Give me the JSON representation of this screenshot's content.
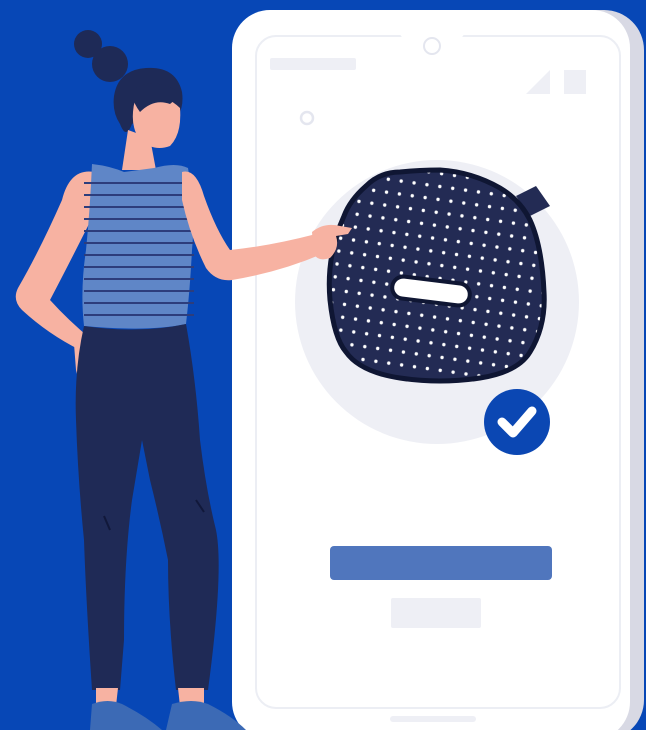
{
  "colors": {
    "background": "#0747b6",
    "phone_body": "#ffffff",
    "phone_edge": "#d8d9e4",
    "phone_shadow": "#0a3d9c",
    "screen_bg": "#ffffff",
    "placeholder_grey": "#eeeff5",
    "speaker_dark": "#232b54",
    "speaker_dots": "#ffffff",
    "check_badge": "#0b47b3",
    "primary_button": "#5076bd",
    "skin": "#f7b2a2",
    "hair": "#1e2a57",
    "top_stripe_a": "#5f86c7",
    "top_stripe_b": "#2d3d7c",
    "pants": "#1f2a56",
    "shoes": "#3c6ab5"
  },
  "icons": {
    "status_signal": "signal-icon",
    "status_battery": "battery-icon",
    "camera": "front-camera-icon",
    "check": "checkmark-icon",
    "device": "bluetooth-speaker-icon"
  }
}
